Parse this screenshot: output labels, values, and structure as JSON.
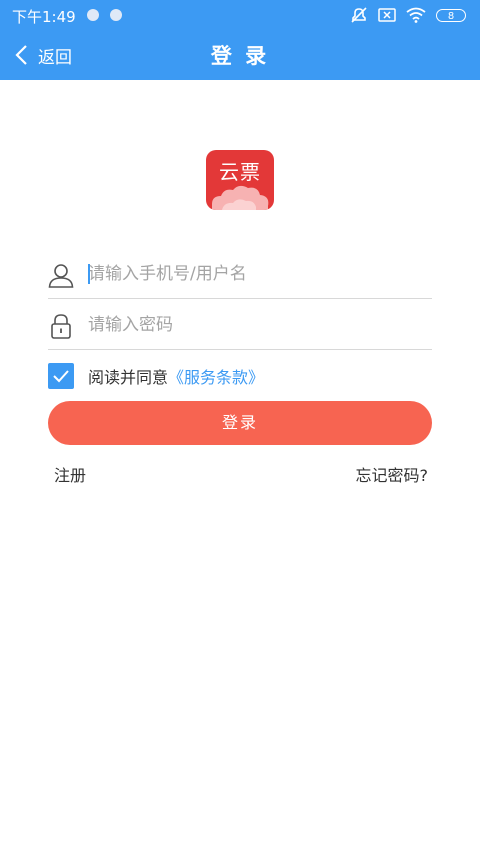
{
  "status_bar": {
    "time": "下午1:49",
    "battery": "8",
    "icons": [
      "notification-dot-icon",
      "notification-dot-icon",
      "mute-icon",
      "no-sim-icon",
      "wifi-icon",
      "battery-icon"
    ]
  },
  "nav": {
    "back_label": "返回",
    "title": "登 录"
  },
  "logo": {
    "text": "云票",
    "color": "#e33838"
  },
  "form": {
    "username_placeholder": "请输入手机号/用户名",
    "password_placeholder": "请输入密码"
  },
  "agreement": {
    "checked": true,
    "text": "阅读并同意",
    "link": "《服务条款》"
  },
  "login_button": "登录",
  "links": {
    "register": "注册",
    "forgot": "忘记密码?"
  },
  "colors": {
    "primary": "#3c9af3",
    "button": "#f76451",
    "logo": "#e33838"
  }
}
